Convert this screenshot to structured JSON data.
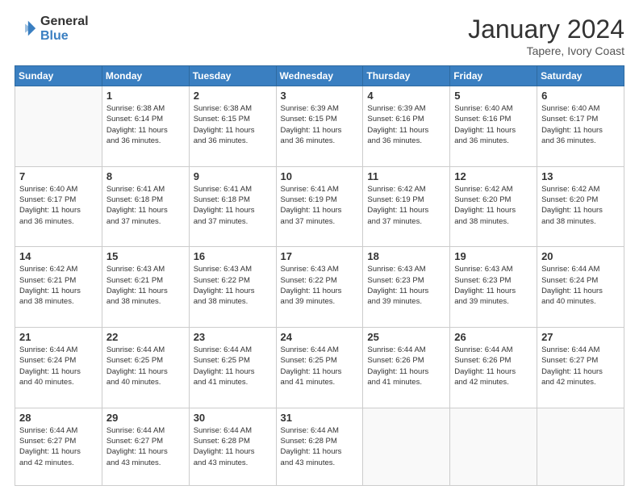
{
  "logo": {
    "general": "General",
    "blue": "Blue"
  },
  "header": {
    "month": "January 2024",
    "location": "Tapere, Ivory Coast"
  },
  "weekdays": [
    "Sunday",
    "Monday",
    "Tuesday",
    "Wednesday",
    "Thursday",
    "Friday",
    "Saturday"
  ],
  "weeks": [
    [
      {
        "day": "",
        "info": ""
      },
      {
        "day": "1",
        "info": "Sunrise: 6:38 AM\nSunset: 6:14 PM\nDaylight: 11 hours\nand 36 minutes."
      },
      {
        "day": "2",
        "info": "Sunrise: 6:38 AM\nSunset: 6:15 PM\nDaylight: 11 hours\nand 36 minutes."
      },
      {
        "day": "3",
        "info": "Sunrise: 6:39 AM\nSunset: 6:15 PM\nDaylight: 11 hours\nand 36 minutes."
      },
      {
        "day": "4",
        "info": "Sunrise: 6:39 AM\nSunset: 6:16 PM\nDaylight: 11 hours\nand 36 minutes."
      },
      {
        "day": "5",
        "info": "Sunrise: 6:40 AM\nSunset: 6:16 PM\nDaylight: 11 hours\nand 36 minutes."
      },
      {
        "day": "6",
        "info": "Sunrise: 6:40 AM\nSunset: 6:17 PM\nDaylight: 11 hours\nand 36 minutes."
      }
    ],
    [
      {
        "day": "7",
        "info": "Sunrise: 6:40 AM\nSunset: 6:17 PM\nDaylight: 11 hours\nand 36 minutes."
      },
      {
        "day": "8",
        "info": "Sunrise: 6:41 AM\nSunset: 6:18 PM\nDaylight: 11 hours\nand 37 minutes."
      },
      {
        "day": "9",
        "info": "Sunrise: 6:41 AM\nSunset: 6:18 PM\nDaylight: 11 hours\nand 37 minutes."
      },
      {
        "day": "10",
        "info": "Sunrise: 6:41 AM\nSunset: 6:19 PM\nDaylight: 11 hours\nand 37 minutes."
      },
      {
        "day": "11",
        "info": "Sunrise: 6:42 AM\nSunset: 6:19 PM\nDaylight: 11 hours\nand 37 minutes."
      },
      {
        "day": "12",
        "info": "Sunrise: 6:42 AM\nSunset: 6:20 PM\nDaylight: 11 hours\nand 38 minutes."
      },
      {
        "day": "13",
        "info": "Sunrise: 6:42 AM\nSunset: 6:20 PM\nDaylight: 11 hours\nand 38 minutes."
      }
    ],
    [
      {
        "day": "14",
        "info": "Sunrise: 6:42 AM\nSunset: 6:21 PM\nDaylight: 11 hours\nand 38 minutes."
      },
      {
        "day": "15",
        "info": "Sunrise: 6:43 AM\nSunset: 6:21 PM\nDaylight: 11 hours\nand 38 minutes."
      },
      {
        "day": "16",
        "info": "Sunrise: 6:43 AM\nSunset: 6:22 PM\nDaylight: 11 hours\nand 38 minutes."
      },
      {
        "day": "17",
        "info": "Sunrise: 6:43 AM\nSunset: 6:22 PM\nDaylight: 11 hours\nand 39 minutes."
      },
      {
        "day": "18",
        "info": "Sunrise: 6:43 AM\nSunset: 6:23 PM\nDaylight: 11 hours\nand 39 minutes."
      },
      {
        "day": "19",
        "info": "Sunrise: 6:43 AM\nSunset: 6:23 PM\nDaylight: 11 hours\nand 39 minutes."
      },
      {
        "day": "20",
        "info": "Sunrise: 6:44 AM\nSunset: 6:24 PM\nDaylight: 11 hours\nand 40 minutes."
      }
    ],
    [
      {
        "day": "21",
        "info": "Sunrise: 6:44 AM\nSunset: 6:24 PM\nDaylight: 11 hours\nand 40 minutes."
      },
      {
        "day": "22",
        "info": "Sunrise: 6:44 AM\nSunset: 6:25 PM\nDaylight: 11 hours\nand 40 minutes."
      },
      {
        "day": "23",
        "info": "Sunrise: 6:44 AM\nSunset: 6:25 PM\nDaylight: 11 hours\nand 41 minutes."
      },
      {
        "day": "24",
        "info": "Sunrise: 6:44 AM\nSunset: 6:25 PM\nDaylight: 11 hours\nand 41 minutes."
      },
      {
        "day": "25",
        "info": "Sunrise: 6:44 AM\nSunset: 6:26 PM\nDaylight: 11 hours\nand 41 minutes."
      },
      {
        "day": "26",
        "info": "Sunrise: 6:44 AM\nSunset: 6:26 PM\nDaylight: 11 hours\nand 42 minutes."
      },
      {
        "day": "27",
        "info": "Sunrise: 6:44 AM\nSunset: 6:27 PM\nDaylight: 11 hours\nand 42 minutes."
      }
    ],
    [
      {
        "day": "28",
        "info": "Sunrise: 6:44 AM\nSunset: 6:27 PM\nDaylight: 11 hours\nand 42 minutes."
      },
      {
        "day": "29",
        "info": "Sunrise: 6:44 AM\nSunset: 6:27 PM\nDaylight: 11 hours\nand 43 minutes."
      },
      {
        "day": "30",
        "info": "Sunrise: 6:44 AM\nSunset: 6:28 PM\nDaylight: 11 hours\nand 43 minutes."
      },
      {
        "day": "31",
        "info": "Sunrise: 6:44 AM\nSunset: 6:28 PM\nDaylight: 11 hours\nand 43 minutes."
      },
      {
        "day": "",
        "info": ""
      },
      {
        "day": "",
        "info": ""
      },
      {
        "day": "",
        "info": ""
      }
    ]
  ]
}
